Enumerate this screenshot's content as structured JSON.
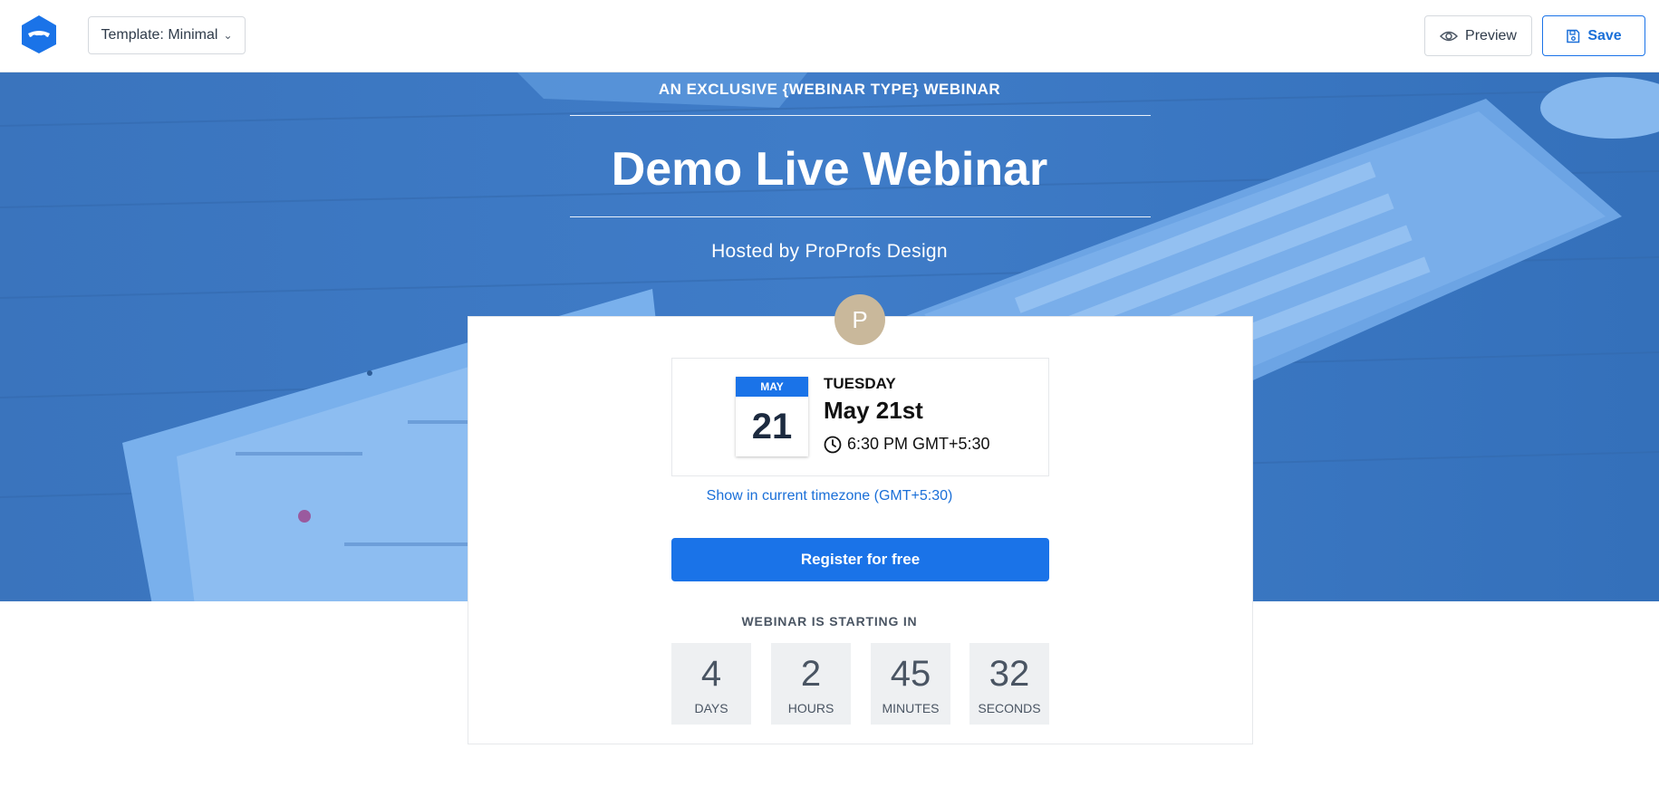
{
  "toolbar": {
    "template_label": "Template: Minimal",
    "preview_label": "Preview",
    "save_label": "Save"
  },
  "hero": {
    "subtitle": "AN EXCLUSIVE {WEBINAR TYPE} WEBINAR",
    "title": "Demo Live Webinar",
    "host": "Hosted by ProProfs Design",
    "background_color": "#3b79c6"
  },
  "host_avatar": {
    "initial": "P",
    "color": "#c9b89b"
  },
  "event": {
    "month": "MAY",
    "day": "21",
    "weekday": "TUESDAY",
    "long_date": "May 21st",
    "time": "6:30 PM GMT+5:30"
  },
  "timezone_link": "Show in current timezone (GMT+5:30)",
  "register_label": "Register for free",
  "countdown": {
    "title": "WEBINAR IS STARTING IN",
    "units": [
      {
        "value": "4",
        "label": "DAYS"
      },
      {
        "value": "2",
        "label": "HOURS"
      },
      {
        "value": "45",
        "label": "MINUTES"
      },
      {
        "value": "32",
        "label": "SECONDS"
      }
    ]
  },
  "colors": {
    "accent": "#1a73e8",
    "link": "#1a6fd8"
  }
}
